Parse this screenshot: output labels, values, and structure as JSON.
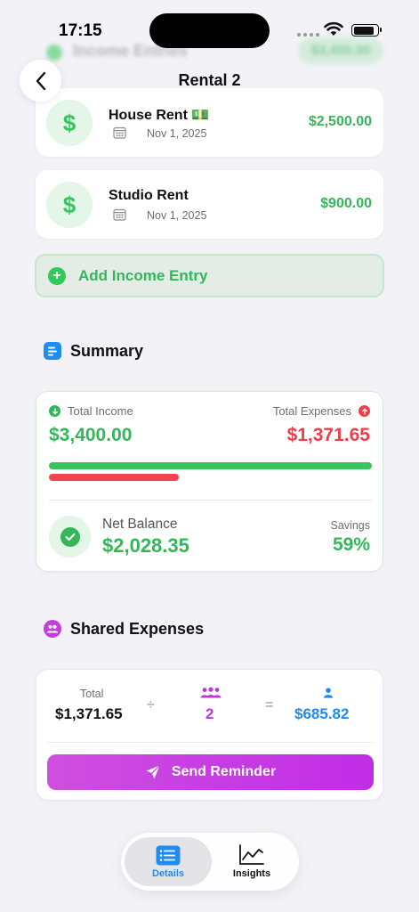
{
  "status_bar": {
    "time": "17:15"
  },
  "ghost_header": {
    "title": "Income Entries",
    "total": "$3,400.00"
  },
  "nav": {
    "title": "Rental 2"
  },
  "income_entries": [
    {
      "name": "House Rent 💵",
      "date": "Nov 1, 2025",
      "amount": "$2,500.00"
    },
    {
      "name": "Studio Rent",
      "date": "Nov 1, 2025",
      "amount": "$900.00"
    }
  ],
  "add_income": {
    "label": "Add Income Entry"
  },
  "summary": {
    "title": "Summary",
    "total_income_label": "Total Income",
    "total_income": "$3,400.00",
    "total_expenses_label": "Total Expenses",
    "total_expenses": "$1,371.65",
    "income_bar_fraction": 1.0,
    "expense_bar_fraction": 0.403,
    "net_balance_label": "Net Balance",
    "net_balance": "$2,028.35",
    "savings_label": "Savings",
    "savings": "59%"
  },
  "shared": {
    "title": "Shared Expenses",
    "total_label": "Total",
    "total": "$1,371.65",
    "divide_symbol": "÷",
    "people_count": "2",
    "equals_symbol": "=",
    "per_person": "$685.82",
    "reminder_label": "Send Reminder"
  },
  "tabs": [
    {
      "label": "Details",
      "active": true
    },
    {
      "label": "Insights",
      "active": false
    }
  ],
  "colors": {
    "green": "#34b75a",
    "red": "#ef3e4a",
    "purple": "#b937d9",
    "blue": "#2389e8"
  }
}
